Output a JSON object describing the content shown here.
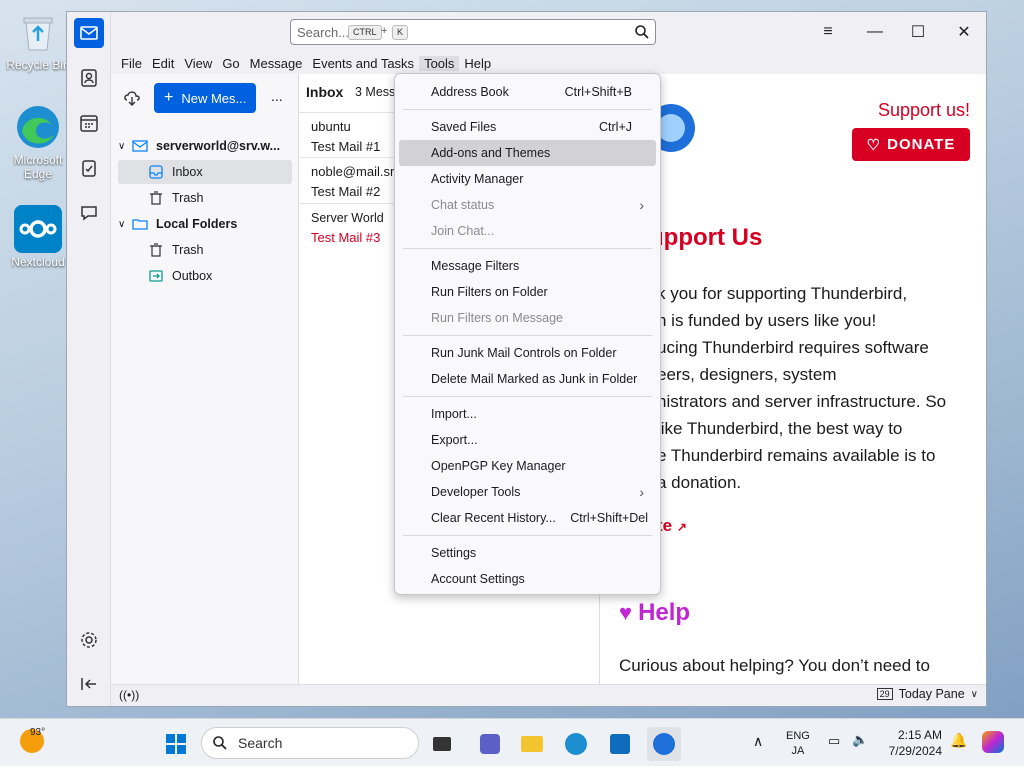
{
  "desktop": {
    "icons": [
      {
        "label": "Recycle Bin"
      },
      {
        "label": "Microsoft Edge"
      },
      {
        "label": "Nextcloud"
      }
    ]
  },
  "window": {
    "search_placeholder": "Search...",
    "search_kbd1": "CTRL",
    "search_plus": "+",
    "search_kbd2": "K",
    "controls": {
      "hamburger": "≡",
      "minimize": "—",
      "maximize": "☐",
      "close": "✕"
    }
  },
  "menubar": [
    "File",
    "Edit",
    "View",
    "Go",
    "Message",
    "Events and Tasks",
    "Tools",
    "Help"
  ],
  "folders": {
    "new_message": "New Mes...",
    "more": "...",
    "account": "serverworld@srv.w...",
    "inbox": "Inbox",
    "trash": "Trash",
    "local_folders": "Local Folders",
    "local_trash": "Trash",
    "outbox": "Outbox"
  },
  "threads": {
    "title": "Inbox",
    "count": "3 Messa",
    "items": [
      {
        "from": "ubuntu",
        "subject": "Test Mail #1"
      },
      {
        "from": "noble@mail.srv",
        "subject": "Test Mail #2"
      },
      {
        "from": "Server World",
        "subject": "Test Mail #3"
      }
    ]
  },
  "message": {
    "support_us": "Support us!",
    "donate": "DONATE",
    "heading": "upport Us",
    "para_lines": [
      "k you for supporting Thunderbird,",
      "h is funded by users like you!",
      "ucing Thunderbird requires software",
      "eers, designers, system",
      "nistrators and server infrastructure. So",
      "like Thunderbird, the best way to",
      "e Thunderbird remains available is to",
      "a donation."
    ],
    "donate_link": "te",
    "help_heading": "Help",
    "help_text": "Curious about helping? You don’t need to"
  },
  "statusbar": {
    "today_pane": "Today Pane",
    "day": "29"
  },
  "tools_menu": {
    "items": [
      {
        "label": "Address Book",
        "shortcut": "Ctrl+Shift+B"
      },
      {
        "label": "Saved Files",
        "shortcut": "Ctrl+J"
      },
      {
        "label": "Add-ons and Themes",
        "shortcut": ""
      },
      {
        "label": "Activity Manager",
        "shortcut": ""
      },
      {
        "label": "Chat status",
        "shortcut": ""
      },
      {
        "label": "Join Chat...",
        "shortcut": ""
      },
      {
        "label": "Message Filters",
        "shortcut": ""
      },
      {
        "label": "Run Filters on Folder",
        "shortcut": ""
      },
      {
        "label": "Run Filters on Message",
        "shortcut": ""
      },
      {
        "label": "Run Junk Mail Controls on Folder",
        "shortcut": ""
      },
      {
        "label": "Delete Mail Marked as Junk in Folder",
        "shortcut": ""
      },
      {
        "label": "Import...",
        "shortcut": ""
      },
      {
        "label": "Export...",
        "shortcut": ""
      },
      {
        "label": "OpenPGP Key Manager",
        "shortcut": ""
      },
      {
        "label": "Developer Tools",
        "shortcut": ""
      },
      {
        "label": "Clear Recent History...",
        "shortcut": "Ctrl+Shift+Del"
      },
      {
        "label": "Settings",
        "shortcut": ""
      },
      {
        "label": "Account Settings",
        "shortcut": ""
      }
    ]
  },
  "taskbar": {
    "weather": "93°",
    "search": "Search",
    "lang1": "ENG",
    "lang2": "JA",
    "time": "2:15 AM",
    "date": "7/29/2024"
  },
  "colors": {
    "accent": "#0061e0",
    "donate": "#d70022",
    "help": "#c026d3",
    "unread": "#d70022"
  }
}
